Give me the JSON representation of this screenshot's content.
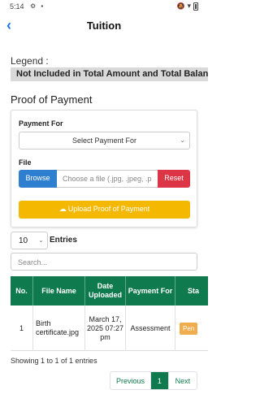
{
  "status": {
    "time": "5:14",
    "left_icons": "⚙ ▪",
    "right_icons": "🔕 ▾"
  },
  "appbar": {
    "title": "Tuition",
    "back_icon": "chevron-left-icon"
  },
  "legend": {
    "label": "Legend :",
    "chip": "Not Included in Total Amount and Total Balance"
  },
  "section": {
    "title": "Proof of Payment"
  },
  "form": {
    "payment_for_label": "Payment For",
    "payment_for_value": "Select Payment For",
    "file_label": "File",
    "browse_label": "Browse",
    "file_placeholder": "Choose a file (.jpg, .jpeg, .p",
    "reset_label": "Reset",
    "upload_label": "Upload Proof of Payment"
  },
  "table_controls": {
    "entries_value": "10",
    "entries_label": "Entries",
    "search_placeholder": "Search..."
  },
  "table": {
    "headers": [
      "No.",
      "File Name",
      "Date Uploaded",
      "Payment For",
      "Sta"
    ],
    "rows": [
      {
        "no": "1",
        "file_name": "Birth certificate.jpg",
        "date": "March 17, 2025 07:27 pm",
        "payment_for": "Assessment",
        "status": "Pen"
      }
    ]
  },
  "footer": {
    "info": "Showing 1 to 1 of 1 entries",
    "prev": "Previous",
    "page": "1",
    "next": "Next"
  },
  "colors": {
    "accent": "#0f7a4d",
    "browse": "#2f7fd1",
    "reset": "#dc3545",
    "upload": "#f5b800",
    "badge": "#f0ad4e"
  }
}
